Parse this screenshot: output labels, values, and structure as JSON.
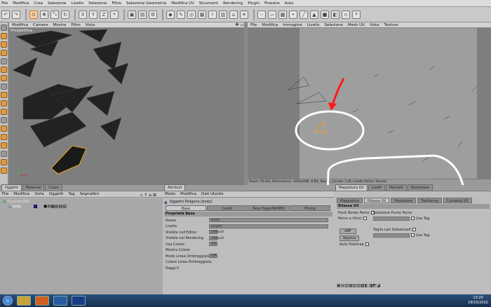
{
  "menu": [
    "File",
    "Modifica",
    "Crea",
    "Selezione",
    "Livello",
    "Selezione",
    "Filtro",
    "Selezione Geometria",
    "Modifica UV",
    "Strumenti",
    "Rendering",
    "Plugin",
    "Finestre",
    "Auto"
  ],
  "viewport": {
    "menu": [
      "Modifica",
      "Camere",
      "Mostra",
      "Filtro",
      "Vista"
    ],
    "label": "Prospettiva"
  },
  "uv_editor": {
    "menu": [
      "File",
      "Modifica",
      "Immagine",
      "Livello",
      "Selezione",
      "Mesh UV",
      "Vista",
      "Texture"
    ],
    "status": "Zoom: 50.8%, Dimensione: 1024x998, 8 Bit, Nuovy_Canale: 1.tif, Livello Attivo: Sfondo"
  },
  "objects": {
    "tabs": [
      "Oggetti",
      "Materiali",
      "Colori"
    ],
    "menu": [
      "File",
      "Modifica",
      "Vista",
      "Oggetti",
      "Tag",
      "Segnalibri"
    ],
    "items": [
      {
        "name": "HyperNURBS"
      },
      {
        "name": "body"
      }
    ]
  },
  "attributes": {
    "tab": "Attributi",
    "menu": [
      "Modo",
      "Modifica",
      "Dati Utente"
    ],
    "object_title": "Oggetto Poligono [body]",
    "subtabs": [
      "Base",
      "Coord.",
      "Peso HyperNURBS",
      "Phong"
    ],
    "section": "Proprietà Base",
    "fields": [
      {
        "label": "Nome",
        "value": "body"
      },
      {
        "label": "Livello",
        "value": "angler"
      },
      {
        "label": "Visibile nell'Editor",
        "value": "Default"
      },
      {
        "label": "Visibile nel Rendering",
        "value": "Default"
      },
      {
        "label": "Usa Colore",
        "value": "Off"
      },
      {
        "label": "Mostra Colore",
        "value": ""
      },
      {
        "label": "Modo Linea Ombreggiata",
        "value": "Off"
      },
      {
        "label": "Colore Linea Ombreggiata",
        "value": ""
      },
      {
        "label": "Raggi-X",
        "value": ""
      }
    ]
  },
  "uv_panel": {
    "tabs": [
      "Mappatura UV",
      "Livelli",
      "Pennelli",
      "Sfumature"
    ],
    "subtabs": [
      "Mappatura",
      "Rilassa UV",
      "Proiezione",
      "Trasforma",
      "Comandi UV"
    ],
    "section": "Rilassa UV",
    "options_left": [
      "Punti Bordo Perno",
      "Perno a Vicini"
    ],
    "option_sel_pin": "Selezione Punto Perno",
    "option_cut": "Taglia Lati Selezionati",
    "use_tag": "Usa Tag",
    "method": "ABF",
    "apply": "Applica",
    "auto_realign": "Auto Riallinea"
  },
  "taskbar": {
    "time": "13:20",
    "date": "29/10/2010"
  },
  "annotation_color": "#ff1a1a"
}
